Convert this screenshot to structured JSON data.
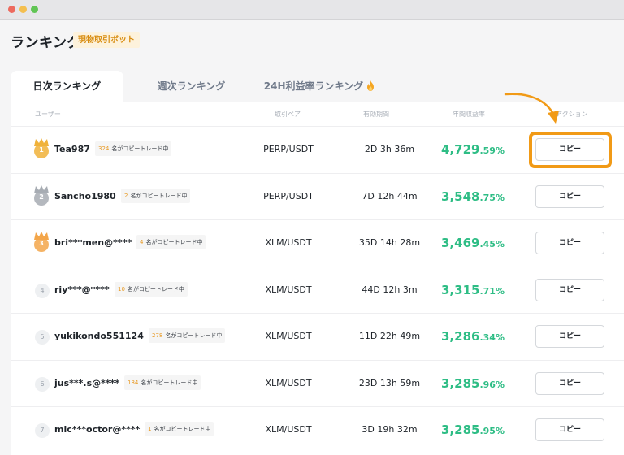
{
  "window": {
    "controls": [
      "close",
      "minimize",
      "zoom"
    ]
  },
  "header": {
    "title": "ランキング",
    "badge": "現物取引ボット"
  },
  "tabs": [
    {
      "label": "日次ランキング",
      "active": true
    },
    {
      "label": "週次ランキング",
      "active": false
    },
    {
      "label": "24H利益率ランキング",
      "active": false,
      "icon": "fire-icon"
    }
  ],
  "columns": {
    "user": "ユーザー",
    "pair": "取引ペア",
    "period": "有効期間",
    "roi": "年間収益率",
    "action": "アクション"
  },
  "copiers_suffix": "名がコピートレード中",
  "rows": [
    {
      "rank": "1",
      "user": "Tea987",
      "copiers": "324",
      "pair": "PERP/USDT",
      "period": "2D 3h 36m",
      "roi_int": "4,729",
      "roi_dec": ".59%",
      "action": "コピー",
      "medal": "gold"
    },
    {
      "rank": "2",
      "user": "Sancho1980",
      "copiers": "2",
      "pair": "PERP/USDT",
      "period": "7D 12h 44m",
      "roi_int": "3,548",
      "roi_dec": ".75%",
      "action": "コピー",
      "medal": "silver"
    },
    {
      "rank": "3",
      "user": "bri***men@****",
      "copiers": "4",
      "pair": "XLM/USDT",
      "period": "35D 14h 28m",
      "roi_int": "3,469",
      "roi_dec": ".45%",
      "action": "コピー",
      "medal": "bronze"
    },
    {
      "rank": "4",
      "user": "riy***@****",
      "copiers": "10",
      "pair": "XLM/USDT",
      "period": "44D 12h 3m",
      "roi_int": "3,315",
      "roi_dec": ".71%",
      "action": "コピー",
      "medal": "none"
    },
    {
      "rank": "5",
      "user": "yukikondo551124",
      "copiers": "278",
      "pair": "XLM/USDT",
      "period": "11D 22h 49m",
      "roi_int": "3,286",
      "roi_dec": ".34%",
      "action": "コピー",
      "medal": "none"
    },
    {
      "rank": "6",
      "user": "jus***.s@****",
      "copiers": "184",
      "pair": "XLM/USDT",
      "period": "23D 13h 59m",
      "roi_int": "3,285",
      "roi_dec": ".96%",
      "action": "コピー",
      "medal": "none"
    },
    {
      "rank": "7",
      "user": "mic***octor@****",
      "copiers": "1",
      "pair": "XLM/USDT",
      "period": "3D 19h 32m",
      "roi_int": "3,285",
      "roi_dec": ".95%",
      "action": "コピー",
      "medal": "none"
    }
  ],
  "colors": {
    "accent": "#f19a16",
    "profit": "#2ebd85",
    "gold": "#f0b23a",
    "silver": "#a7acb3",
    "bronze": "#f3a64a"
  }
}
